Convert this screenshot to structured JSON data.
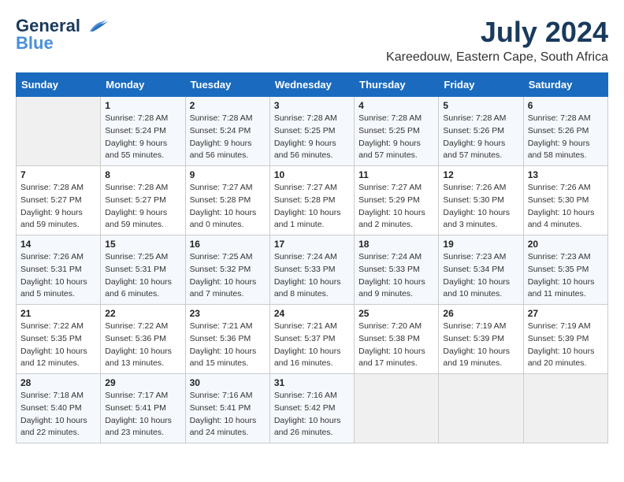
{
  "logo": {
    "line1": "General",
    "line2": "Blue"
  },
  "title": "July 2024",
  "subtitle": "Kareedouw, Eastern Cape, South Africa",
  "days_of_week": [
    "Sunday",
    "Monday",
    "Tuesday",
    "Wednesday",
    "Thursday",
    "Friday",
    "Saturday"
  ],
  "weeks": [
    [
      {
        "num": "",
        "sunrise": "",
        "sunset": "",
        "daylight": "",
        "empty": true
      },
      {
        "num": "1",
        "sunrise": "Sunrise: 7:28 AM",
        "sunset": "Sunset: 5:24 PM",
        "daylight": "Daylight: 9 hours and 55 minutes."
      },
      {
        "num": "2",
        "sunrise": "Sunrise: 7:28 AM",
        "sunset": "Sunset: 5:24 PM",
        "daylight": "Daylight: 9 hours and 56 minutes."
      },
      {
        "num": "3",
        "sunrise": "Sunrise: 7:28 AM",
        "sunset": "Sunset: 5:25 PM",
        "daylight": "Daylight: 9 hours and 56 minutes."
      },
      {
        "num": "4",
        "sunrise": "Sunrise: 7:28 AM",
        "sunset": "Sunset: 5:25 PM",
        "daylight": "Daylight: 9 hours and 57 minutes."
      },
      {
        "num": "5",
        "sunrise": "Sunrise: 7:28 AM",
        "sunset": "Sunset: 5:26 PM",
        "daylight": "Daylight: 9 hours and 57 minutes."
      },
      {
        "num": "6",
        "sunrise": "Sunrise: 7:28 AM",
        "sunset": "Sunset: 5:26 PM",
        "daylight": "Daylight: 9 hours and 58 minutes."
      }
    ],
    [
      {
        "num": "7",
        "sunrise": "Sunrise: 7:28 AM",
        "sunset": "Sunset: 5:27 PM",
        "daylight": "Daylight: 9 hours and 59 minutes."
      },
      {
        "num": "8",
        "sunrise": "Sunrise: 7:28 AM",
        "sunset": "Sunset: 5:27 PM",
        "daylight": "Daylight: 9 hours and 59 minutes."
      },
      {
        "num": "9",
        "sunrise": "Sunrise: 7:27 AM",
        "sunset": "Sunset: 5:28 PM",
        "daylight": "Daylight: 10 hours and 0 minutes."
      },
      {
        "num": "10",
        "sunrise": "Sunrise: 7:27 AM",
        "sunset": "Sunset: 5:28 PM",
        "daylight": "Daylight: 10 hours and 1 minute."
      },
      {
        "num": "11",
        "sunrise": "Sunrise: 7:27 AM",
        "sunset": "Sunset: 5:29 PM",
        "daylight": "Daylight: 10 hours and 2 minutes."
      },
      {
        "num": "12",
        "sunrise": "Sunrise: 7:26 AM",
        "sunset": "Sunset: 5:30 PM",
        "daylight": "Daylight: 10 hours and 3 minutes."
      },
      {
        "num": "13",
        "sunrise": "Sunrise: 7:26 AM",
        "sunset": "Sunset: 5:30 PM",
        "daylight": "Daylight: 10 hours and 4 minutes."
      }
    ],
    [
      {
        "num": "14",
        "sunrise": "Sunrise: 7:26 AM",
        "sunset": "Sunset: 5:31 PM",
        "daylight": "Daylight: 10 hours and 5 minutes."
      },
      {
        "num": "15",
        "sunrise": "Sunrise: 7:25 AM",
        "sunset": "Sunset: 5:31 PM",
        "daylight": "Daylight: 10 hours and 6 minutes."
      },
      {
        "num": "16",
        "sunrise": "Sunrise: 7:25 AM",
        "sunset": "Sunset: 5:32 PM",
        "daylight": "Daylight: 10 hours and 7 minutes."
      },
      {
        "num": "17",
        "sunrise": "Sunrise: 7:24 AM",
        "sunset": "Sunset: 5:33 PM",
        "daylight": "Daylight: 10 hours and 8 minutes."
      },
      {
        "num": "18",
        "sunrise": "Sunrise: 7:24 AM",
        "sunset": "Sunset: 5:33 PM",
        "daylight": "Daylight: 10 hours and 9 minutes."
      },
      {
        "num": "19",
        "sunrise": "Sunrise: 7:23 AM",
        "sunset": "Sunset: 5:34 PM",
        "daylight": "Daylight: 10 hours and 10 minutes."
      },
      {
        "num": "20",
        "sunrise": "Sunrise: 7:23 AM",
        "sunset": "Sunset: 5:35 PM",
        "daylight": "Daylight: 10 hours and 11 minutes."
      }
    ],
    [
      {
        "num": "21",
        "sunrise": "Sunrise: 7:22 AM",
        "sunset": "Sunset: 5:35 PM",
        "daylight": "Daylight: 10 hours and 12 minutes."
      },
      {
        "num": "22",
        "sunrise": "Sunrise: 7:22 AM",
        "sunset": "Sunset: 5:36 PM",
        "daylight": "Daylight: 10 hours and 13 minutes."
      },
      {
        "num": "23",
        "sunrise": "Sunrise: 7:21 AM",
        "sunset": "Sunset: 5:36 PM",
        "daylight": "Daylight: 10 hours and 15 minutes."
      },
      {
        "num": "24",
        "sunrise": "Sunrise: 7:21 AM",
        "sunset": "Sunset: 5:37 PM",
        "daylight": "Daylight: 10 hours and 16 minutes."
      },
      {
        "num": "25",
        "sunrise": "Sunrise: 7:20 AM",
        "sunset": "Sunset: 5:38 PM",
        "daylight": "Daylight: 10 hours and 17 minutes."
      },
      {
        "num": "26",
        "sunrise": "Sunrise: 7:19 AM",
        "sunset": "Sunset: 5:39 PM",
        "daylight": "Daylight: 10 hours and 19 minutes."
      },
      {
        "num": "27",
        "sunrise": "Sunrise: 7:19 AM",
        "sunset": "Sunset: 5:39 PM",
        "daylight": "Daylight: 10 hours and 20 minutes."
      }
    ],
    [
      {
        "num": "28",
        "sunrise": "Sunrise: 7:18 AM",
        "sunset": "Sunset: 5:40 PM",
        "daylight": "Daylight: 10 hours and 22 minutes."
      },
      {
        "num": "29",
        "sunrise": "Sunrise: 7:17 AM",
        "sunset": "Sunset: 5:41 PM",
        "daylight": "Daylight: 10 hours and 23 minutes."
      },
      {
        "num": "30",
        "sunrise": "Sunrise: 7:16 AM",
        "sunset": "Sunset: 5:41 PM",
        "daylight": "Daylight: 10 hours and 24 minutes."
      },
      {
        "num": "31",
        "sunrise": "Sunrise: 7:16 AM",
        "sunset": "Sunset: 5:42 PM",
        "daylight": "Daylight: 10 hours and 26 minutes."
      },
      {
        "num": "",
        "sunrise": "",
        "sunset": "",
        "daylight": "",
        "empty": true
      },
      {
        "num": "",
        "sunrise": "",
        "sunset": "",
        "daylight": "",
        "empty": true
      },
      {
        "num": "",
        "sunrise": "",
        "sunset": "",
        "daylight": "",
        "empty": true
      }
    ]
  ]
}
